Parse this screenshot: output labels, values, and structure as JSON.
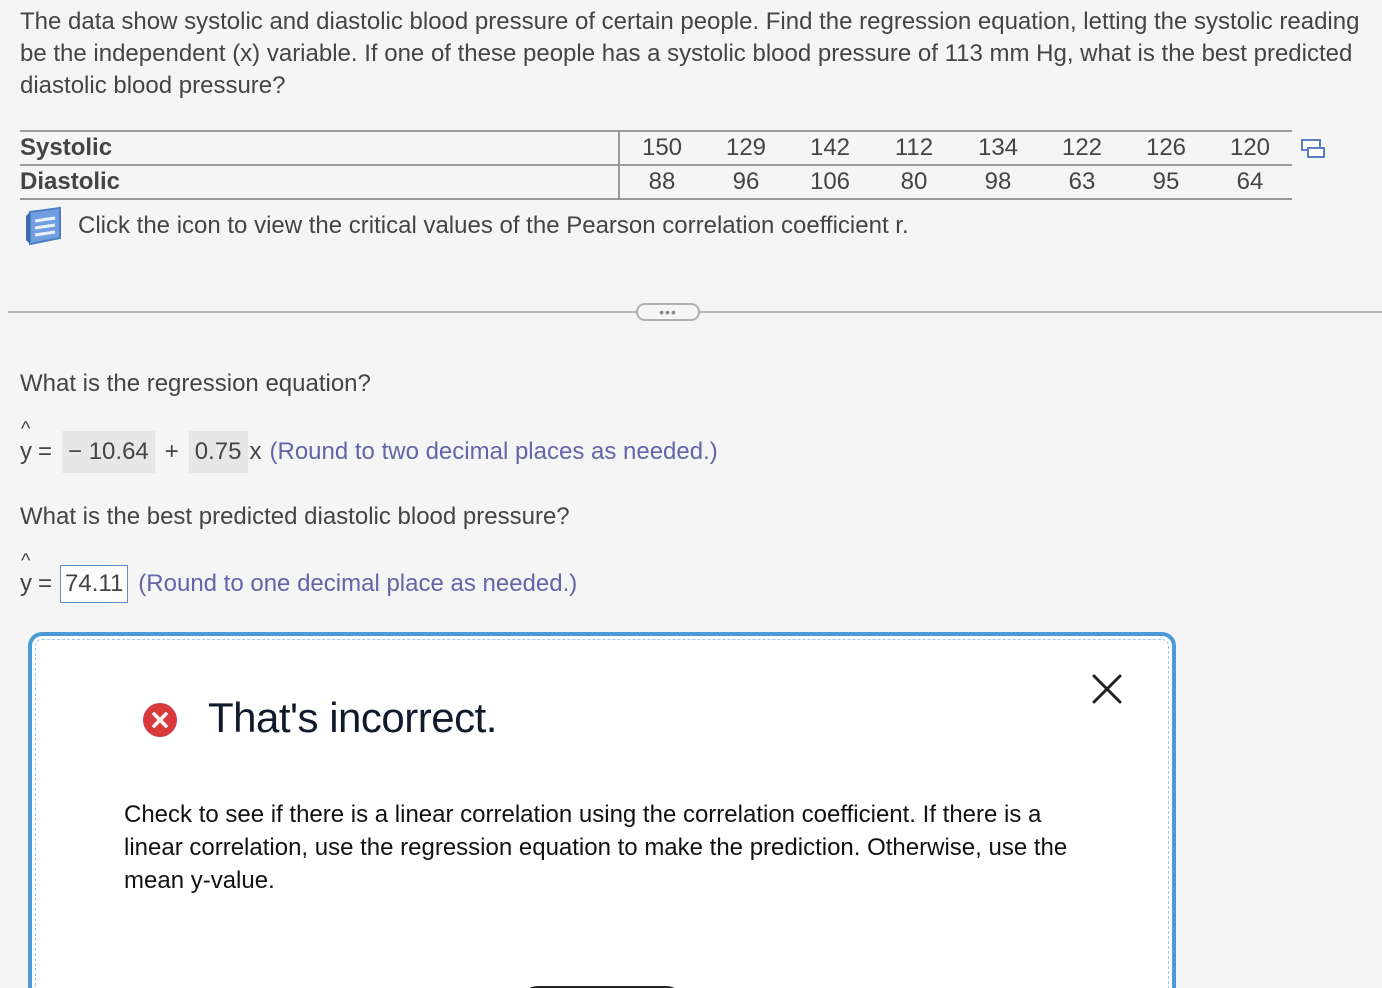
{
  "question": "The data show systolic and diastolic blood pressure of certain people. Find the regression equation, letting the systolic reading be the independent (x) variable. If one of these people has a systolic blood pressure of 113 mm Hg, what is the best predicted diastolic blood pressure?",
  "table": {
    "row1_label": "Systolic",
    "row2_label": "Diastolic",
    "systolic": [
      "150",
      "129",
      "142",
      "112",
      "134",
      "122",
      "126",
      "120"
    ],
    "diastolic": [
      "88",
      "96",
      "106",
      "80",
      "98",
      "63",
      "95",
      "64"
    ]
  },
  "hint_text": "Click the icon to view the critical values of the Pearson correlation coefficient r.",
  "more_label": "•••",
  "q1": {
    "prompt": "What is the regression equation?",
    "yhat_label": "y",
    "equals": "=",
    "intercept": "− 10.64",
    "plus": "+",
    "slope": "0.75",
    "x_var": "x",
    "note": "(Round to two decimal places as needed.)"
  },
  "q2": {
    "prompt": "What is the best predicted diastolic blood pressure?",
    "yhat_label": "y",
    "equals": "=",
    "answer": "74.11",
    "note": "(Round to one decimal place as needed.)"
  },
  "feedback": {
    "title": "That's incorrect.",
    "message": "Check to see if there is a linear correlation using the correlation coefficient. If there is a linear correlation, use the regression equation to make the prediction. Otherwise, use the mean y-value."
  },
  "colors": {
    "accent": "#4a9bd8",
    "error": "#d93b3b",
    "note": "#6464a8"
  },
  "icons": [
    "copy-table-icon",
    "book-icon",
    "error-x-icon",
    "close-icon"
  ]
}
